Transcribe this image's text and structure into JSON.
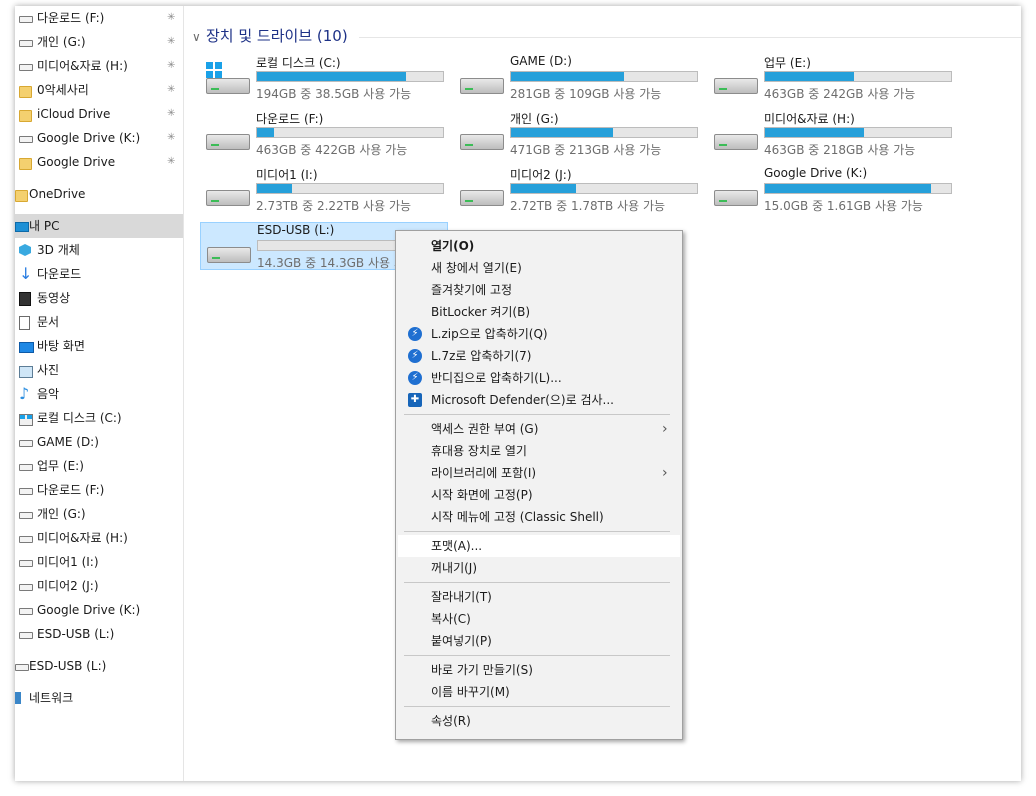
{
  "nav": {
    "items": [
      {
        "label": "다운로드 (F:)",
        "icon": "drive-icon",
        "pinned": true
      },
      {
        "label": "개인 (G:)",
        "icon": "drive-icon",
        "pinned": true
      },
      {
        "label": "미디어&자료 (H:)",
        "icon": "drive-icon",
        "pinned": true
      },
      {
        "label": "0악세사리",
        "icon": "folder-icon",
        "pinned": true
      },
      {
        "label": "iCloud Drive",
        "icon": "folder-icon",
        "pinned": true
      },
      {
        "label": "Google Drive (K:)",
        "icon": "drive-icon",
        "pinned": true
      },
      {
        "label": "Google Drive",
        "icon": "folder-icon",
        "pinned": true
      },
      {
        "label": "OneDrive",
        "icon": "folder-icon",
        "pinned": false
      },
      {
        "label": "내 PC",
        "icon": "pc-icon",
        "pinned": false,
        "selected": true
      },
      {
        "label": "3D 개체",
        "icon": "3d-objects-icon",
        "pinned": false
      },
      {
        "label": "다운로드",
        "icon": "download-arrow-icon",
        "pinned": false
      },
      {
        "label": "동영상",
        "icon": "video-icon",
        "pinned": false
      },
      {
        "label": "문서",
        "icon": "document-icon",
        "pinned": false
      },
      {
        "label": "바탕 화면",
        "icon": "desktop-icon",
        "pinned": false
      },
      {
        "label": "사진",
        "icon": "pictures-icon",
        "pinned": false
      },
      {
        "label": "음악",
        "icon": "music-icon",
        "pinned": false
      },
      {
        "label": "로컬 디스크 (C:)",
        "icon": "os-drive-icon",
        "pinned": false
      },
      {
        "label": "GAME (D:)",
        "icon": "drive-icon",
        "pinned": false
      },
      {
        "label": "업무 (E:)",
        "icon": "drive-icon",
        "pinned": false
      },
      {
        "label": "다운로드 (F:)",
        "icon": "drive-icon",
        "pinned": false
      },
      {
        "label": "개인 (G:)",
        "icon": "drive-icon",
        "pinned": false
      },
      {
        "label": "미디어&자료 (H:)",
        "icon": "drive-icon",
        "pinned": false
      },
      {
        "label": "미디어1 (I:)",
        "icon": "drive-icon",
        "pinned": false
      },
      {
        "label": "미디어2 (J:)",
        "icon": "drive-icon",
        "pinned": false
      },
      {
        "label": "Google Drive (K:)",
        "icon": "drive-icon",
        "pinned": false
      },
      {
        "label": "ESD-USB (L:)",
        "icon": "drive-icon",
        "pinned": false
      },
      {
        "label": "ESD-USB (L:)",
        "icon": "drive-icon",
        "pinned": false
      },
      {
        "label": "네트워크",
        "icon": "network-icon",
        "pinned": false
      }
    ]
  },
  "group": {
    "title": "장치 및 드라이브 (10)"
  },
  "drives": [
    {
      "name": "로컬 디스크 (C:)",
      "size_text": "194GB 중 38.5GB 사용 가능",
      "used_fraction": 0.8,
      "os": true
    },
    {
      "name": "GAME (D:)",
      "size_text": "281GB 중 109GB 사용 가능",
      "used_fraction": 0.61,
      "os": false
    },
    {
      "name": "업무 (E:)",
      "size_text": "463GB 중 242GB 사용 가능",
      "used_fraction": 0.48,
      "os": false
    },
    {
      "name": "다운로드 (F:)",
      "size_text": "463GB 중 422GB 사용 가능",
      "used_fraction": 0.09,
      "os": false
    },
    {
      "name": "개인 (G:)",
      "size_text": "471GB 중 213GB 사용 가능",
      "used_fraction": 0.55,
      "os": false
    },
    {
      "name": "미디어&자료 (H:)",
      "size_text": "463GB 중 218GB 사용 가능",
      "used_fraction": 0.53,
      "os": false
    },
    {
      "name": "미디어1 (I:)",
      "size_text": "2.73TB 중 2.22TB 사용 가능",
      "used_fraction": 0.19,
      "os": false
    },
    {
      "name": "미디어2 (J:)",
      "size_text": "2.72TB 중 1.78TB 사용 가능",
      "used_fraction": 0.35,
      "os": false
    },
    {
      "name": "Google Drive (K:)",
      "size_text": "15.0GB 중 1.61GB 사용 가능",
      "used_fraction": 0.89,
      "os": false
    },
    {
      "name": "ESD-USB (L:)",
      "size_text": "14.3GB 중 14.3GB 사용 가능",
      "used_fraction": 0.0,
      "os": false,
      "selected": true
    }
  ],
  "context_menu": {
    "groups": [
      [
        {
          "label": "열기(O)",
          "bold": true
        },
        {
          "label": "새 창에서 열기(E)"
        },
        {
          "label": "즐겨찾기에 고정"
        },
        {
          "label": "BitLocker 켜기(B)"
        },
        {
          "label": "L.zip으로 압축하기(Q)",
          "icon": "bandizip-icon"
        },
        {
          "label": "L.7z로 압축하기(7)",
          "icon": "bandizip-icon"
        },
        {
          "label": "반디집으로 압축하기(L)...",
          "icon": "bandizip-icon"
        },
        {
          "label": "Microsoft Defender(으)로 검사...",
          "icon": "defender-shield-icon"
        }
      ],
      [
        {
          "label": "액세스 권한 부여 (G)",
          "submenu": true
        },
        {
          "label": "휴대용 장치로 열기"
        },
        {
          "label": "라이브러리에 포함(I)",
          "submenu": true
        },
        {
          "label": "시작 화면에 고정(P)"
        },
        {
          "label": "시작 메뉴에 고정 (Classic Shell)"
        }
      ],
      [
        {
          "label": "포맷(A)...",
          "hover": true
        },
        {
          "label": "꺼내기(J)"
        }
      ],
      [
        {
          "label": "잘라내기(T)"
        },
        {
          "label": "복사(C)"
        },
        {
          "label": "붙여넣기(P)"
        }
      ],
      [
        {
          "label": "바로 가기 만들기(S)"
        },
        {
          "label": "이름 바꾸기(M)"
        }
      ],
      [
        {
          "label": "속성(R)"
        }
      ]
    ]
  },
  "colors": {
    "usage_bar": "#26a0da",
    "selection": "#cce8ff",
    "group_header": "#1e3287"
  }
}
